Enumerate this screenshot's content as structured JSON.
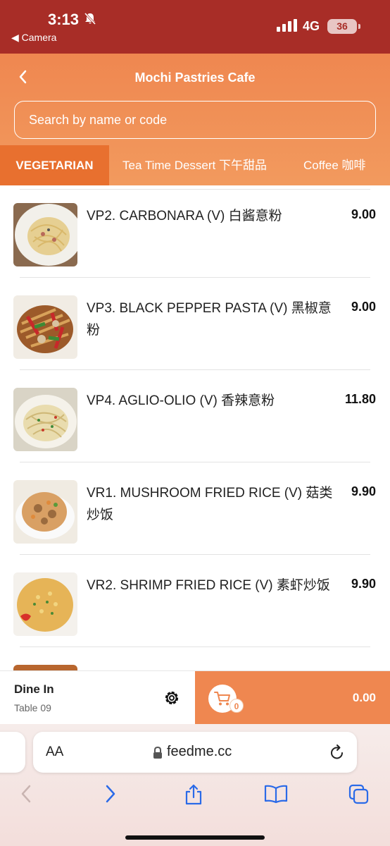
{
  "status_bar": {
    "time": "3:13",
    "back_app": "◀ Camera",
    "network": "4G",
    "battery": "36"
  },
  "header": {
    "title": "Mochi Pastries Cafe"
  },
  "search": {
    "placeholder": "Search by name or code"
  },
  "tabs": [
    {
      "label": "VEGETARIAN"
    },
    {
      "label": "Tea Time Dessert 下午甜品"
    },
    {
      "label": "Coffee 咖啡"
    }
  ],
  "menu_items": [
    {
      "name": "VP2. CARBONARA (V) 白酱意粉",
      "price": "9.00"
    },
    {
      "name": "VP3. BLACK PEPPER PASTA (V) 黑椒意粉",
      "price": "9.00"
    },
    {
      "name": "VP4. AGLIO-OLIO (V) 香辣意粉",
      "price": "11.80"
    },
    {
      "name": "VR1. MUSHROOM FRIED RICE (V) 菇类炒饭",
      "price": "9.90"
    },
    {
      "name": "VR2. SHRIMP FRIED RICE (V) 素虾炒饭",
      "price": "9.90"
    }
  ],
  "order_bar": {
    "dine_mode": "Dine In",
    "table": "Table 09",
    "cart_count": "0",
    "total": "0.00"
  },
  "browser": {
    "text_size_label": "AA",
    "url": "feedme.cc"
  },
  "colors": {
    "status_bar": "#a82d27",
    "accent": "#ef8750",
    "active_tab": "#e8702f"
  }
}
